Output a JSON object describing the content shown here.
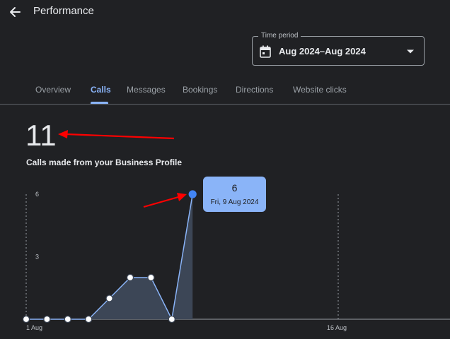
{
  "header": {
    "title": "Performance",
    "back_icon": "arrow-back-icon"
  },
  "time_period": {
    "label": "Time period",
    "value": "Aug 2024–Aug 2024",
    "icon": "calendar-icon"
  },
  "tabs": [
    {
      "label": "Overview",
      "active": false
    },
    {
      "label": "Calls",
      "active": true
    },
    {
      "label": "Messages",
      "active": false
    },
    {
      "label": "Bookings",
      "active": false
    },
    {
      "label": "Directions",
      "active": false
    },
    {
      "label": "Website clicks",
      "active": false
    }
  ],
  "metric": {
    "value": "11",
    "description": "Calls made from your Business Profile"
  },
  "tooltip": {
    "value": "6",
    "date": "Fri, 9 Aug 2024"
  },
  "colors": {
    "accent": "#8ab4f8",
    "point": "#4285f4",
    "annotation": "#ff0000",
    "background": "#202124"
  },
  "chart_data": {
    "type": "area",
    "x": [
      "1 Aug",
      "2 Aug",
      "3 Aug",
      "4 Aug",
      "5 Aug",
      "6 Aug",
      "7 Aug",
      "8 Aug",
      "9 Aug"
    ],
    "values": [
      0,
      0,
      0,
      0,
      1,
      2,
      2,
      0,
      6
    ],
    "highlighted_index": 8,
    "y_ticks": [
      "3",
      "6"
    ],
    "x_ticks": [
      "1 Aug",
      "16 Aug"
    ],
    "ylim": [
      0,
      6
    ],
    "x_range_days": [
      1,
      31
    ]
  }
}
